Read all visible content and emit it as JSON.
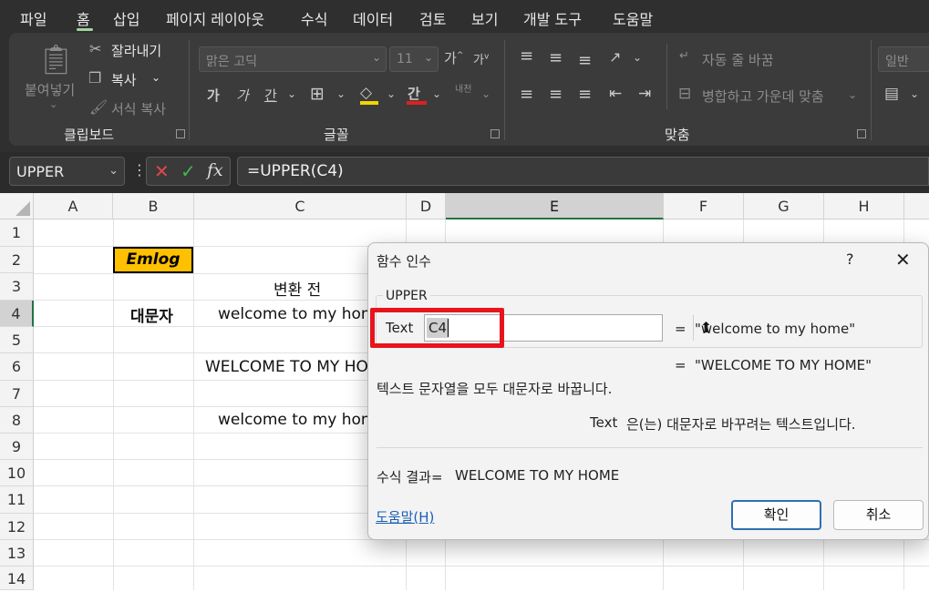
{
  "menu": {
    "items": [
      "파일",
      "홈",
      "삽입",
      "페이지 레이아웃",
      "수식",
      "데이터",
      "검토",
      "보기",
      "개발 도구",
      "도움말"
    ],
    "active_index": 1
  },
  "ribbon": {
    "clipboard": {
      "paste_label": "붙여넣기",
      "cut_label": "잘라내기",
      "copy_label": "복사",
      "format_painter_label": "서식 복사",
      "group_label": "클립보드"
    },
    "font": {
      "font_name": "맑은 고딕",
      "font_size": "11",
      "bold": "가",
      "italic": "가",
      "underline": "간",
      "font_color": "간",
      "phonetic_label": "내천",
      "group_label": "글꼴"
    },
    "alignment": {
      "wrap_text_label": "자동 줄 바꿈",
      "merge_center_label": "병합하고 가운데 맞춤",
      "group_label": "맞춤"
    },
    "number": {
      "format": "일반"
    }
  },
  "formula_bar": {
    "name_box": "UPPER",
    "formula": "=UPPER(C4)"
  },
  "grid": {
    "columns": [
      "A",
      "B",
      "C",
      "D",
      "E",
      "F",
      "G",
      "H"
    ],
    "selected_column": "E",
    "rows": [
      "1",
      "2",
      "3",
      "4",
      "5",
      "6",
      "7",
      "8",
      "9",
      "10",
      "11",
      "12",
      "13",
      "14"
    ],
    "selected_row": "4",
    "cells": {
      "b2": "Emlog",
      "c3": "변환 전",
      "b4": "대문자",
      "c4": "welcome to my home",
      "c6": "WELCOME TO MY HOME",
      "c8": "welcome to my home"
    }
  },
  "dialog": {
    "title": "함수 인수",
    "help_char": "?",
    "function_name": "UPPER",
    "arg_label": "Text",
    "arg_value": "C4",
    "arg_result": "\"welcome to my home\"",
    "function_result": "\"WELCOME TO MY HOME\"",
    "equals": "=",
    "description": "텍스트 문자열을 모두 대문자로 바꿉니다.",
    "arg_desc_name": "Text",
    "arg_description": "은(는) 대문자로 바꾸려는 텍스트입니다.",
    "result_label": "수식 결과=",
    "result_value": "WELCOME TO MY HOME",
    "help_link": "도움말(H)",
    "ok_label": "확인",
    "cancel_label": "취소"
  },
  "colors": {
    "accent_red": "#e8141c",
    "header_green": "#217346",
    "cell_highlight": "#ffc000",
    "link": "#1a5fb4"
  }
}
